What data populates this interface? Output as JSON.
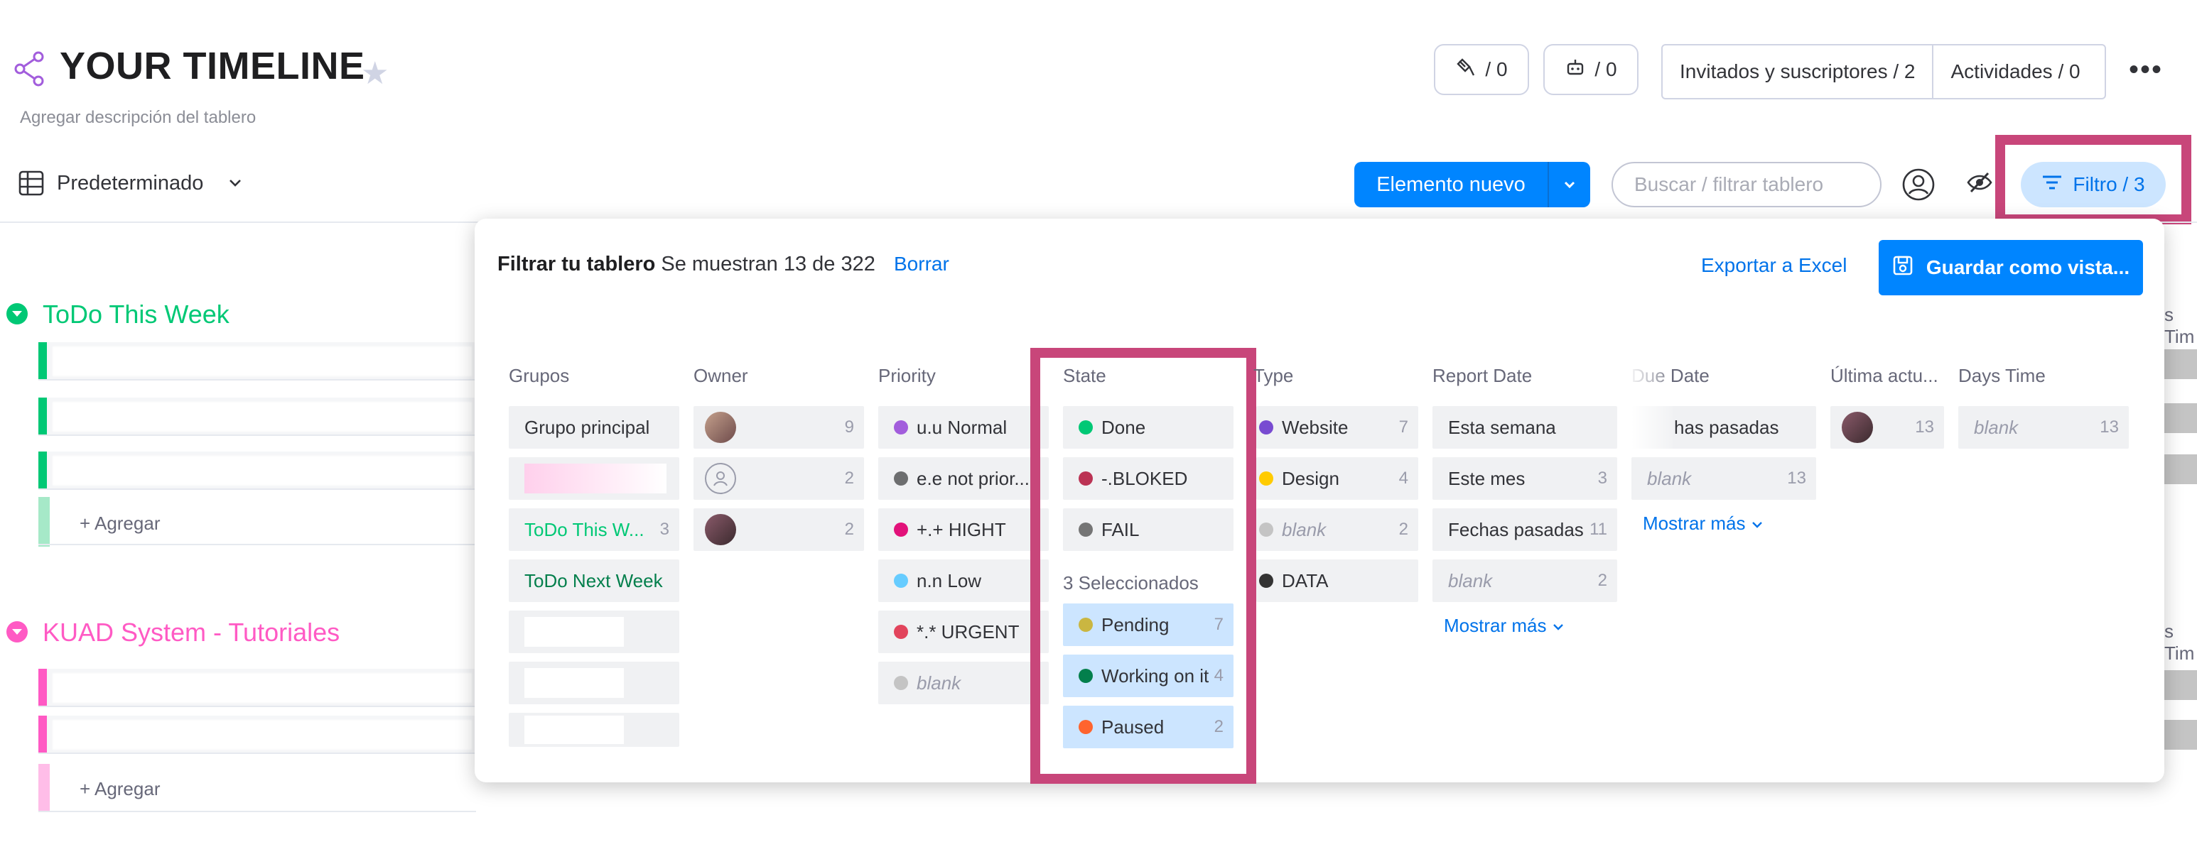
{
  "header": {
    "title": "YOUR TIMELINE",
    "subtitle": "Agregar descripción del tablero",
    "integrations_count": "/ 0",
    "automations_count": "/ 0",
    "guests_label": "Invitados y suscriptores / 2",
    "activities_label": "Actividades / 0"
  },
  "toolbar": {
    "view_label": "Predeterminado",
    "new_item_label": "Elemento nuevo",
    "search_placeholder": "Buscar / filtrar tablero",
    "filter_label": "Filtro / 3"
  },
  "board": {
    "groups": [
      {
        "title": "ToDo This Week",
        "color": "#00c875",
        "add_label": "+ Agregar"
      },
      {
        "title": "KUAD System - Tutoriales",
        "color": "#ff5ac4",
        "add_label": "+ Agregar"
      }
    ],
    "right_edge_label": "s Tim"
  },
  "filter_panel": {
    "title": "Filtrar tu tablero",
    "summary": "Se muestran 13 de 322",
    "clear_label": "Borrar",
    "export_label": "Exportar a Excel",
    "save_label": "Guardar como vista...",
    "selected_label": "3 Seleccionados",
    "columns": {
      "grupos": {
        "header": "Grupos",
        "items": [
          {
            "label": "Grupo principal",
            "count": ""
          },
          {
            "label": "",
            "count": ""
          },
          {
            "label": "ToDo This W...",
            "count": "3"
          },
          {
            "label": "ToDo Next Week",
            "count": ""
          }
        ]
      },
      "owner": {
        "header": "Owner",
        "items": [
          {
            "count": "9"
          },
          {
            "count": "2"
          },
          {
            "count": "2"
          }
        ]
      },
      "priority": {
        "header": "Priority",
        "items": [
          {
            "label": "u.u Normal",
            "color": "#a25ddc"
          },
          {
            "label": "e.e not prior...",
            "color": "#6d6e6f"
          },
          {
            "label": "+.+ HIGHT",
            "color": "#e2127a"
          },
          {
            "label": "n.n Low",
            "color": "#66ccff"
          },
          {
            "label": "*.* URGENT",
            "color": "#e2445c"
          },
          {
            "label": "blank",
            "color": "#c4c4c4"
          }
        ]
      },
      "state": {
        "header": "State",
        "items": [
          {
            "label": "Done",
            "color": "#00c875"
          },
          {
            "label": "-.BLOKED",
            "color": "#bb3354"
          },
          {
            "label": "FAIL",
            "color": "#757575"
          }
        ],
        "selected": [
          {
            "label": "Pending",
            "color": "#cab641",
            "count": "7"
          },
          {
            "label": "Working on it",
            "color": "#037f4c",
            "count": "4"
          },
          {
            "label": "Paused",
            "color": "#ff642e",
            "count": "2"
          }
        ]
      },
      "type": {
        "header": "Type",
        "items": [
          {
            "label": "Website",
            "color": "#784bd1",
            "count": "7"
          },
          {
            "label": "Design",
            "color": "#ffcb00",
            "count": "4"
          },
          {
            "label": "blank",
            "color": "#c4c4c4",
            "count": "2"
          },
          {
            "label": "DATA",
            "color": "#333333",
            "count": ""
          }
        ]
      },
      "report_date": {
        "header": "Report Date",
        "items": [
          {
            "label": "Esta semana",
            "count": ""
          },
          {
            "label": "Este mes",
            "count": "3"
          },
          {
            "label": "Fechas pasadas",
            "count": "11"
          },
          {
            "label": "blank",
            "count": "2"
          }
        ],
        "more_label": "Mostrar más"
      },
      "due_date": {
        "header": "Due Date",
        "items": [
          {
            "label": "has pasadas",
            "count": ""
          },
          {
            "label": "blank",
            "count": "13"
          }
        ],
        "more_label": "Mostrar más"
      },
      "last_update": {
        "header": "Última actu...",
        "items": [
          {
            "count": "13"
          }
        ]
      },
      "days_time": {
        "header": "Days Time",
        "items": [
          {
            "label": "blank",
            "count": "13"
          }
        ]
      }
    }
  }
}
